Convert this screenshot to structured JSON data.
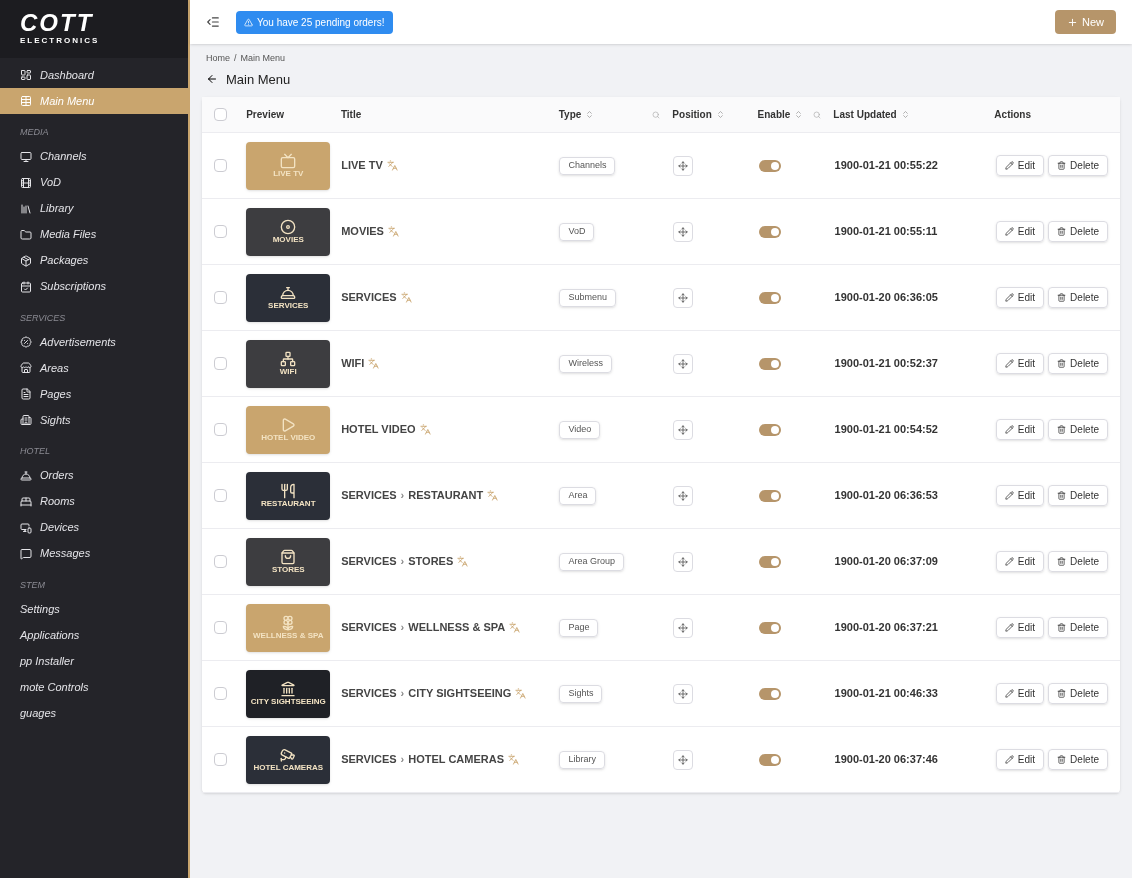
{
  "sidebar": {
    "logo": "COTT",
    "logo_sub": "ELECTRONICS",
    "sections": [
      {
        "items": [
          {
            "label": "Dashboard",
            "selected": false
          },
          {
            "label": "Main Menu",
            "selected": true
          }
        ]
      },
      {
        "heading": "MEDIA",
        "items": [
          {
            "label": "Channels",
            "selected": false
          },
          {
            "label": "VoD",
            "selected": false
          },
          {
            "label": "Library",
            "selected": false
          },
          {
            "label": "Media Files",
            "selected": false
          },
          {
            "label": "Packages",
            "selected": false
          },
          {
            "label": "Subscriptions",
            "selected": false
          }
        ]
      },
      {
        "heading": "SERVICES",
        "items": [
          {
            "label": "Advertisements",
            "selected": false
          },
          {
            "label": "Areas",
            "selected": false
          },
          {
            "label": "Pages",
            "selected": false
          },
          {
            "label": "Sights",
            "selected": false
          }
        ]
      },
      {
        "heading": "HOTEL",
        "items": [
          {
            "label": "Orders",
            "selected": false
          },
          {
            "label": "Rooms",
            "selected": false
          },
          {
            "label": "Devices",
            "selected": false
          },
          {
            "label": "Messages",
            "selected": false
          }
        ]
      },
      {
        "heading": "STEM",
        "items": [
          {
            "label": "Settings",
            "selected": false
          },
          {
            "label": "Applications",
            "selected": false
          },
          {
            "label": "pp Installer",
            "selected": false
          },
          {
            "label": "mote Controls",
            "selected": false
          },
          {
            "label": "guages",
            "selected": false
          }
        ]
      }
    ]
  },
  "topbar": {
    "alert": "You have 25 pending orders!",
    "new_button": "New"
  },
  "breadcrumb": [
    "Home",
    "/",
    "Main Menu"
  ],
  "page_title": "Main Menu",
  "table": {
    "select_all_checked": false,
    "columns": [
      "Preview",
      "Title",
      "Type",
      "Position",
      "Enable",
      "Last Updated",
      "Actions"
    ],
    "rows": [
      {
        "checked": false,
        "preview": "LIVE TV",
        "color": "#c9a56e",
        "title": [
          "LIVE TV"
        ],
        "type": "Channels",
        "enabled": true,
        "updated": "1900-01-21 00:55:22",
        "edit": "Edit",
        "delete": "Delete"
      },
      {
        "checked": false,
        "preview": "MOVIES",
        "color": "#3d3d40",
        "title": [
          "MOVIES"
        ],
        "type": "VoD",
        "enabled": true,
        "updated": "1900-01-21 00:55:11",
        "edit": "Edit",
        "delete": "Delete"
      },
      {
        "checked": false,
        "preview": "SERVICES",
        "color": "#2b2f38",
        "title": [
          "SERVICES"
        ],
        "type": "Submenu",
        "enabled": true,
        "updated": "1900-01-20 06:36:05",
        "edit": "Edit",
        "delete": "Delete"
      },
      {
        "checked": false,
        "preview": "WIFI",
        "color": "#3d3d40",
        "title": [
          "WIFI"
        ],
        "type": "Wireless",
        "enabled": true,
        "updated": "1900-01-21 00:52:37",
        "edit": "Edit",
        "delete": "Delete"
      },
      {
        "checked": false,
        "preview": "HOTEL VIDEO",
        "color": "#c9a56e",
        "title": [
          "HOTEL VIDEO"
        ],
        "type": "Video",
        "enabled": true,
        "updated": "1900-01-21 00:54:52",
        "edit": "Edit",
        "delete": "Delete"
      },
      {
        "checked": false,
        "preview": "RESTAURANT",
        "color": "#2b2f38",
        "title": [
          "SERVICES",
          "›",
          "RESTAURANT"
        ],
        "type": "Area",
        "enabled": true,
        "updated": "1900-01-20 06:36:53",
        "edit": "Edit",
        "delete": "Delete"
      },
      {
        "checked": false,
        "preview": "STORES",
        "color": "#3d3d40",
        "title": [
          "SERVICES",
          "›",
          "STORES"
        ],
        "type": "Area Group",
        "enabled": true,
        "updated": "1900-01-20 06:37:09",
        "edit": "Edit",
        "delete": "Delete"
      },
      {
        "checked": false,
        "preview": "WELLNESS & SPA",
        "color": "#c9a56e",
        "title": [
          "SERVICES",
          "›",
          "WELLNESS & SPA"
        ],
        "type": "Page",
        "enabled": true,
        "updated": "1900-01-20 06:37:21",
        "edit": "Edit",
        "delete": "Delete"
      },
      {
        "checked": false,
        "preview": "CITY SIGHTSEEING",
        "color": "#1f2126",
        "title": [
          "SERVICES",
          "›",
          "CITY SIGHTSEEING"
        ],
        "type": "Sights",
        "enabled": true,
        "updated": "1900-01-21 00:46:33",
        "edit": "Edit",
        "delete": "Delete"
      },
      {
        "checked": false,
        "preview": "HOTEL CAMERAS",
        "color": "#2b2f38",
        "title": [
          "SERVICES",
          "›",
          "HOTEL CAMERAS"
        ],
        "type": "Library",
        "enabled": true,
        "updated": "1900-01-20 06:37:46",
        "edit": "Edit",
        "delete": "Delete"
      }
    ]
  }
}
